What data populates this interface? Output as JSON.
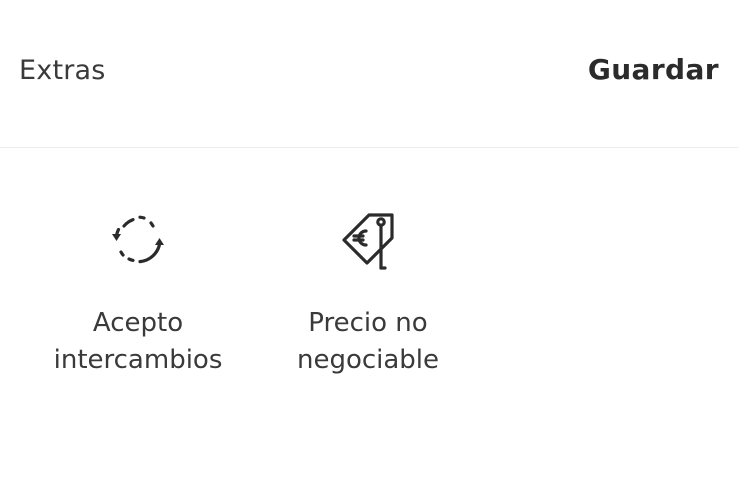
{
  "header": {
    "title": "Extras",
    "save_label": "Guardar"
  },
  "options": [
    {
      "icon": "exchange-arrows-icon",
      "label": "Acepto\nintercambios"
    },
    {
      "icon": "euro-price-tag-icon",
      "label": "Precio no\nnegociable"
    }
  ]
}
